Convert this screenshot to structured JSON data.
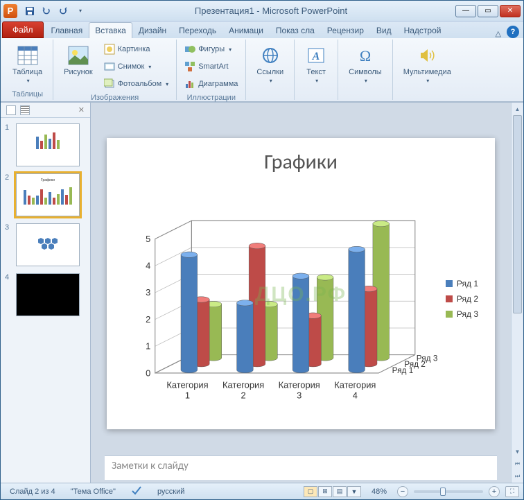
{
  "titlebar": {
    "app_letter": "P",
    "title": "Презентация1  -  Microsoft PowerPoint"
  },
  "ribbon_tabs": {
    "file": "Файл",
    "tabs": [
      "Главная",
      "Вставка",
      "Дизайн",
      "Переходь",
      "Анимаци",
      "Показ сла",
      "Рецензир",
      "Вид",
      "Надстрой"
    ],
    "active_index": 1
  },
  "ribbon": {
    "groups": {
      "tables": {
        "label": "Таблицы",
        "table_btn": "Таблица"
      },
      "images": {
        "label": "Изображения",
        "picture": "Рисунок",
        "clipart": "Картинка",
        "screenshot": "Снимок",
        "photoalbum": "Фотоальбом"
      },
      "illustrations": {
        "label": "Иллюстрации",
        "shapes": "Фигуры",
        "smartart": "SmartArt",
        "chart": "Диаграмма"
      },
      "links": {
        "label": "",
        "links_btn": "Ссылки"
      },
      "text": {
        "label": "",
        "text_btn": "Текст"
      },
      "symbols": {
        "label": "",
        "symbols_btn": "Символы"
      },
      "media": {
        "label": "",
        "media_btn": "Мультимедиа"
      }
    }
  },
  "slide": {
    "title": "Графики",
    "watermark": "ДЦО.РФ"
  },
  "notes": {
    "placeholder": "Заметки к слайду"
  },
  "statusbar": {
    "slide_counter": "Слайд 2 из 4",
    "theme": "\"Тема Office\"",
    "language": "русский",
    "zoom": "48%"
  },
  "chart_data": {
    "type": "bar",
    "title": "Графики",
    "categories": [
      "Категория 1",
      "Категория 2",
      "Категория 3",
      "Категория 4"
    ],
    "depth_labels": [
      "Ряд 1",
      "Ряд 2",
      "Ряд 3"
    ],
    "series": [
      {
        "name": "Ряд 1",
        "color": "#4a7ebb",
        "values": [
          4.3,
          2.5,
          3.5,
          4.5
        ]
      },
      {
        "name": "Ряд 2",
        "color": "#be4b48",
        "values": [
          2.4,
          4.4,
          1.8,
          2.8
        ]
      },
      {
        "name": "Ряд 3",
        "color": "#98b954",
        "values": [
          2.0,
          2.0,
          3.0,
          5.0
        ]
      }
    ],
    "ylabel": "",
    "xlabel": "",
    "ylim": [
      0,
      5
    ],
    "y_ticks": [
      0,
      1,
      2,
      3,
      4,
      5
    ]
  },
  "thumbnails": [
    {
      "num": "1",
      "kind": "chart"
    },
    {
      "num": "2",
      "kind": "chart",
      "active": true
    },
    {
      "num": "3",
      "kind": "hexagons"
    },
    {
      "num": "4",
      "kind": "black"
    }
  ]
}
